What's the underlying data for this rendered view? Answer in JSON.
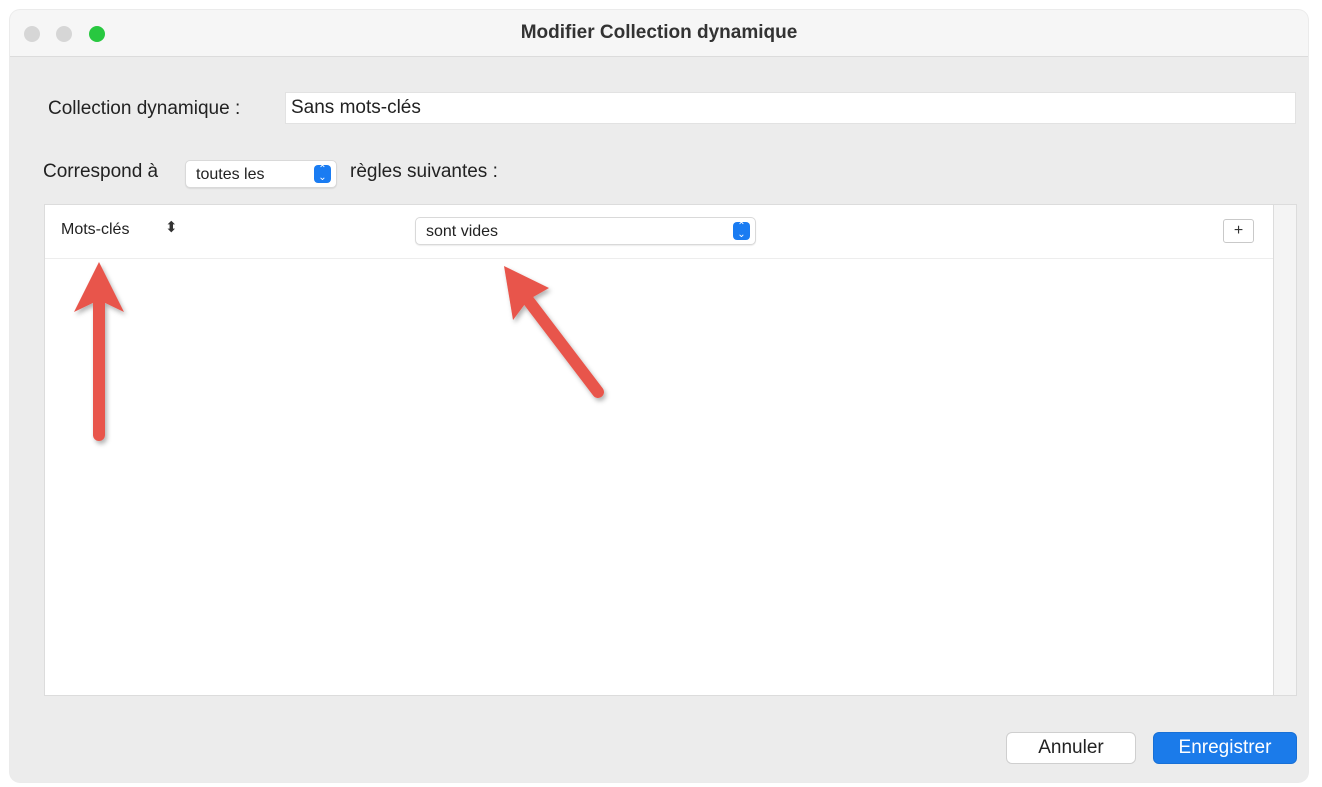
{
  "window": {
    "title": "Modifier Collection dynamique"
  },
  "form": {
    "name_label": "Collection dynamique :",
    "name_value": "Sans mots-clés",
    "match_label_before": "Correspond à",
    "match_value": "toutes les",
    "match_label_after": "règles suivantes :"
  },
  "rule": {
    "field": "Mots-clés",
    "condition": "sont vides",
    "add_label": "+"
  },
  "buttons": {
    "cancel": "Annuler",
    "save": "Enregistrer"
  },
  "annotations": {
    "arrow_color": "#e8554b"
  },
  "colors": {
    "accent": "#1b7bea",
    "zoom": "#28c840"
  }
}
